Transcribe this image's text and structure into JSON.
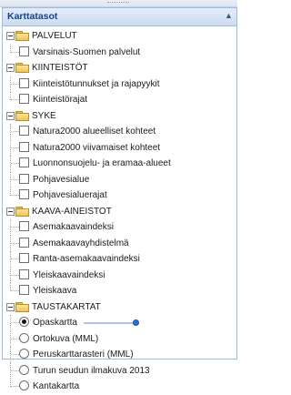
{
  "panel": {
    "title": "Karttatasot"
  },
  "groups": [
    {
      "label": "PALVELUT",
      "items": [
        "Varsinais-Suomen palvelut"
      ]
    },
    {
      "label": "KIINTEISTÖT",
      "items": [
        "Kiinteistötunnukset ja rajapyykit",
        "Kiinteistörajat"
      ]
    },
    {
      "label": "SYKE",
      "items": [
        "Natura2000 alueelliset kohteet",
        "Natura2000 viivamaiset kohteet",
        "Luonnonsuojelu- ja eramaa-alueet",
        "Pohjavesialue",
        "Pohjavesialuerajat"
      ]
    },
    {
      "label": "KAAVA-AINEISTOT",
      "items": [
        "Asemakaavaindeksi",
        "Asemakaavayhdistelmä",
        "Ranta-asemakaavaindeksi",
        "Yleiskaavaindeksi",
        "Yleiskaava"
      ]
    },
    {
      "label": "TAUSTAKARTAT",
      "items": [
        "Opaskartta",
        "Ortokuva (MML)",
        "Peruskarttarasteri (MML)",
        "Turun seudun ilmakuva 2013",
        "Kantakartta"
      ]
    }
  ],
  "basemap": {
    "selected_index": 0,
    "opacity": 1.0
  },
  "colors": {
    "header_text": "#15428b",
    "border": "#99bbe8",
    "folder": "#f0c45a"
  }
}
